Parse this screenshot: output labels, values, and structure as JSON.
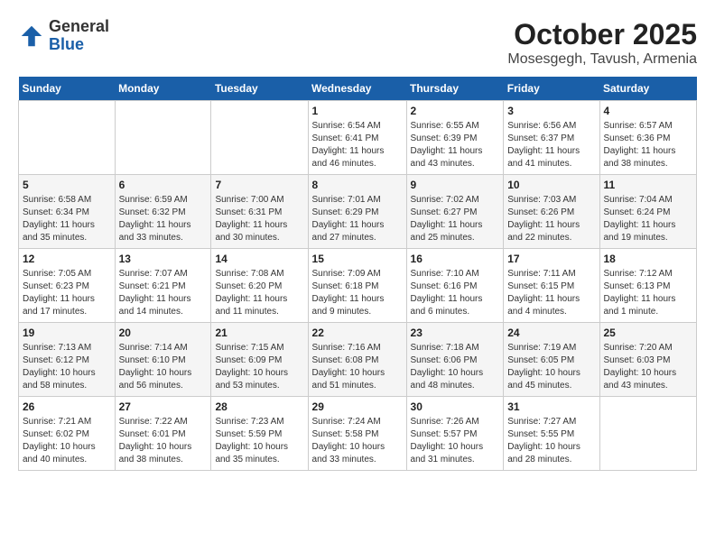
{
  "logo": {
    "general": "General",
    "blue": "Blue"
  },
  "title": {
    "month": "October 2025",
    "location": "Mosesgegh, Tavush, Armenia"
  },
  "headers": [
    "Sunday",
    "Monday",
    "Tuesday",
    "Wednesday",
    "Thursday",
    "Friday",
    "Saturday"
  ],
  "weeks": [
    [
      {
        "day": "",
        "info": ""
      },
      {
        "day": "",
        "info": ""
      },
      {
        "day": "",
        "info": ""
      },
      {
        "day": "1",
        "info": "Sunrise: 6:54 AM\nSunset: 6:41 PM\nDaylight: 11 hours\nand 46 minutes."
      },
      {
        "day": "2",
        "info": "Sunrise: 6:55 AM\nSunset: 6:39 PM\nDaylight: 11 hours\nand 43 minutes."
      },
      {
        "day": "3",
        "info": "Sunrise: 6:56 AM\nSunset: 6:37 PM\nDaylight: 11 hours\nand 41 minutes."
      },
      {
        "day": "4",
        "info": "Sunrise: 6:57 AM\nSunset: 6:36 PM\nDaylight: 11 hours\nand 38 minutes."
      }
    ],
    [
      {
        "day": "5",
        "info": "Sunrise: 6:58 AM\nSunset: 6:34 PM\nDaylight: 11 hours\nand 35 minutes."
      },
      {
        "day": "6",
        "info": "Sunrise: 6:59 AM\nSunset: 6:32 PM\nDaylight: 11 hours\nand 33 minutes."
      },
      {
        "day": "7",
        "info": "Sunrise: 7:00 AM\nSunset: 6:31 PM\nDaylight: 11 hours\nand 30 minutes."
      },
      {
        "day": "8",
        "info": "Sunrise: 7:01 AM\nSunset: 6:29 PM\nDaylight: 11 hours\nand 27 minutes."
      },
      {
        "day": "9",
        "info": "Sunrise: 7:02 AM\nSunset: 6:27 PM\nDaylight: 11 hours\nand 25 minutes."
      },
      {
        "day": "10",
        "info": "Sunrise: 7:03 AM\nSunset: 6:26 PM\nDaylight: 11 hours\nand 22 minutes."
      },
      {
        "day": "11",
        "info": "Sunrise: 7:04 AM\nSunset: 6:24 PM\nDaylight: 11 hours\nand 19 minutes."
      }
    ],
    [
      {
        "day": "12",
        "info": "Sunrise: 7:05 AM\nSunset: 6:23 PM\nDaylight: 11 hours\nand 17 minutes."
      },
      {
        "day": "13",
        "info": "Sunrise: 7:07 AM\nSunset: 6:21 PM\nDaylight: 11 hours\nand 14 minutes."
      },
      {
        "day": "14",
        "info": "Sunrise: 7:08 AM\nSunset: 6:20 PM\nDaylight: 11 hours\nand 11 minutes."
      },
      {
        "day": "15",
        "info": "Sunrise: 7:09 AM\nSunset: 6:18 PM\nDaylight: 11 hours\nand 9 minutes."
      },
      {
        "day": "16",
        "info": "Sunrise: 7:10 AM\nSunset: 6:16 PM\nDaylight: 11 hours\nand 6 minutes."
      },
      {
        "day": "17",
        "info": "Sunrise: 7:11 AM\nSunset: 6:15 PM\nDaylight: 11 hours\nand 4 minutes."
      },
      {
        "day": "18",
        "info": "Sunrise: 7:12 AM\nSunset: 6:13 PM\nDaylight: 11 hours\nand 1 minute."
      }
    ],
    [
      {
        "day": "19",
        "info": "Sunrise: 7:13 AM\nSunset: 6:12 PM\nDaylight: 10 hours\nand 58 minutes."
      },
      {
        "day": "20",
        "info": "Sunrise: 7:14 AM\nSunset: 6:10 PM\nDaylight: 10 hours\nand 56 minutes."
      },
      {
        "day": "21",
        "info": "Sunrise: 7:15 AM\nSunset: 6:09 PM\nDaylight: 10 hours\nand 53 minutes."
      },
      {
        "day": "22",
        "info": "Sunrise: 7:16 AM\nSunset: 6:08 PM\nDaylight: 10 hours\nand 51 minutes."
      },
      {
        "day": "23",
        "info": "Sunrise: 7:18 AM\nSunset: 6:06 PM\nDaylight: 10 hours\nand 48 minutes."
      },
      {
        "day": "24",
        "info": "Sunrise: 7:19 AM\nSunset: 6:05 PM\nDaylight: 10 hours\nand 45 minutes."
      },
      {
        "day": "25",
        "info": "Sunrise: 7:20 AM\nSunset: 6:03 PM\nDaylight: 10 hours\nand 43 minutes."
      }
    ],
    [
      {
        "day": "26",
        "info": "Sunrise: 7:21 AM\nSunset: 6:02 PM\nDaylight: 10 hours\nand 40 minutes."
      },
      {
        "day": "27",
        "info": "Sunrise: 7:22 AM\nSunset: 6:01 PM\nDaylight: 10 hours\nand 38 minutes."
      },
      {
        "day": "28",
        "info": "Sunrise: 7:23 AM\nSunset: 5:59 PM\nDaylight: 10 hours\nand 35 minutes."
      },
      {
        "day": "29",
        "info": "Sunrise: 7:24 AM\nSunset: 5:58 PM\nDaylight: 10 hours\nand 33 minutes."
      },
      {
        "day": "30",
        "info": "Sunrise: 7:26 AM\nSunset: 5:57 PM\nDaylight: 10 hours\nand 31 minutes."
      },
      {
        "day": "31",
        "info": "Sunrise: 7:27 AM\nSunset: 5:55 PM\nDaylight: 10 hours\nand 28 minutes."
      },
      {
        "day": "",
        "info": ""
      }
    ]
  ]
}
